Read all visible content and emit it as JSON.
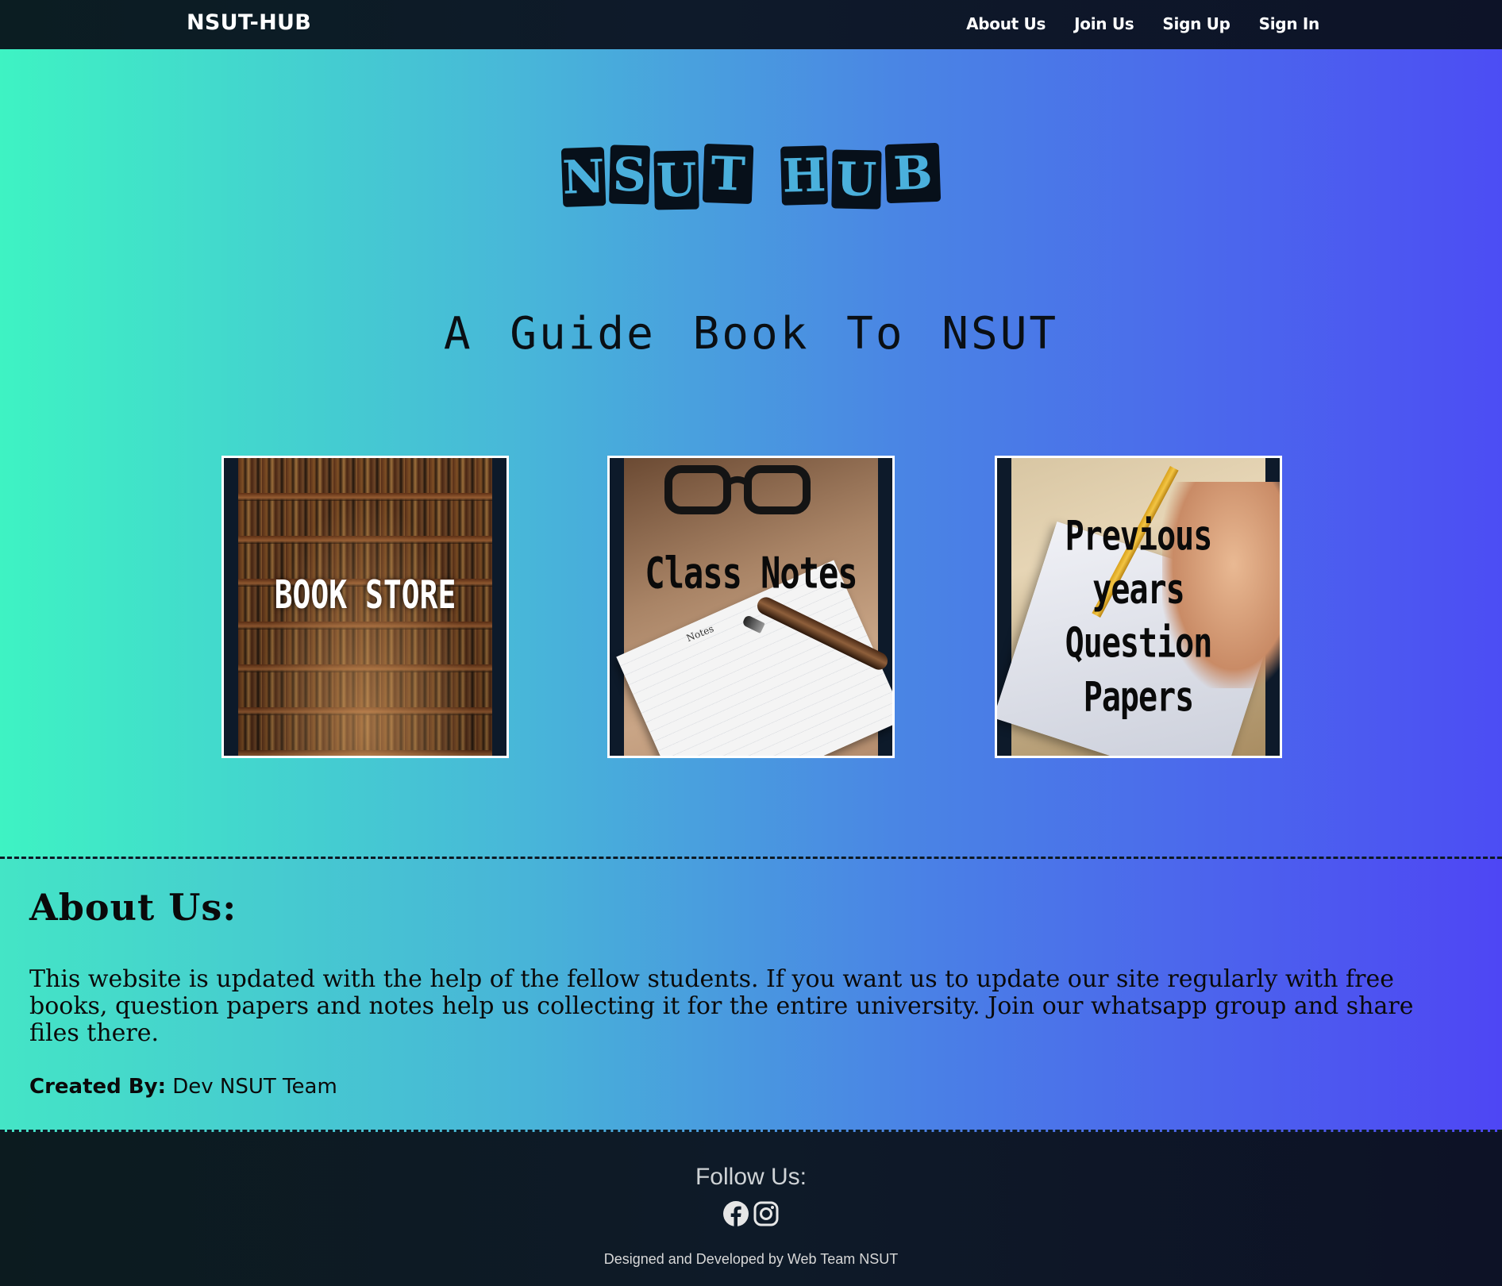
{
  "navbar": {
    "brand": "NSUT-HUB",
    "links": [
      "About Us",
      "Join Us",
      "Sign Up",
      "Sign In"
    ]
  },
  "hero": {
    "title_letters": [
      "N",
      "S",
      "U",
      "T",
      "H",
      "U",
      "B"
    ],
    "tagline": "A Guide Book To NSUT"
  },
  "cards": [
    {
      "caption": "BOOK STORE"
    },
    {
      "caption": "Class Notes",
      "paper_label": "Notes"
    },
    {
      "caption_line1": "Previous years",
      "caption_line2": "Question Papers"
    }
  ],
  "about": {
    "heading": "About Us:",
    "text": "This website is updated with the help of the fellow students. If you want us to update our site regularly with free books, question papers and notes help us collecting it for the entire university. Join our whatsapp group and share files there.",
    "created_by_label": "Created By:",
    "created_by_value": " Dev NSUT Team"
  },
  "footer": {
    "follow": "Follow Us:",
    "social_icons": [
      "facebook-icon",
      "instagram-icon"
    ],
    "credits": "Designed and Developed by Web Team NSUT"
  },
  "colors": {
    "navbar_bg": "#0d1a24",
    "gradient_start": "#3ef3c3",
    "gradient_end": "#4c4df4",
    "stamp_text": "#4ab0dc",
    "stamp_bg": "#07101a"
  }
}
